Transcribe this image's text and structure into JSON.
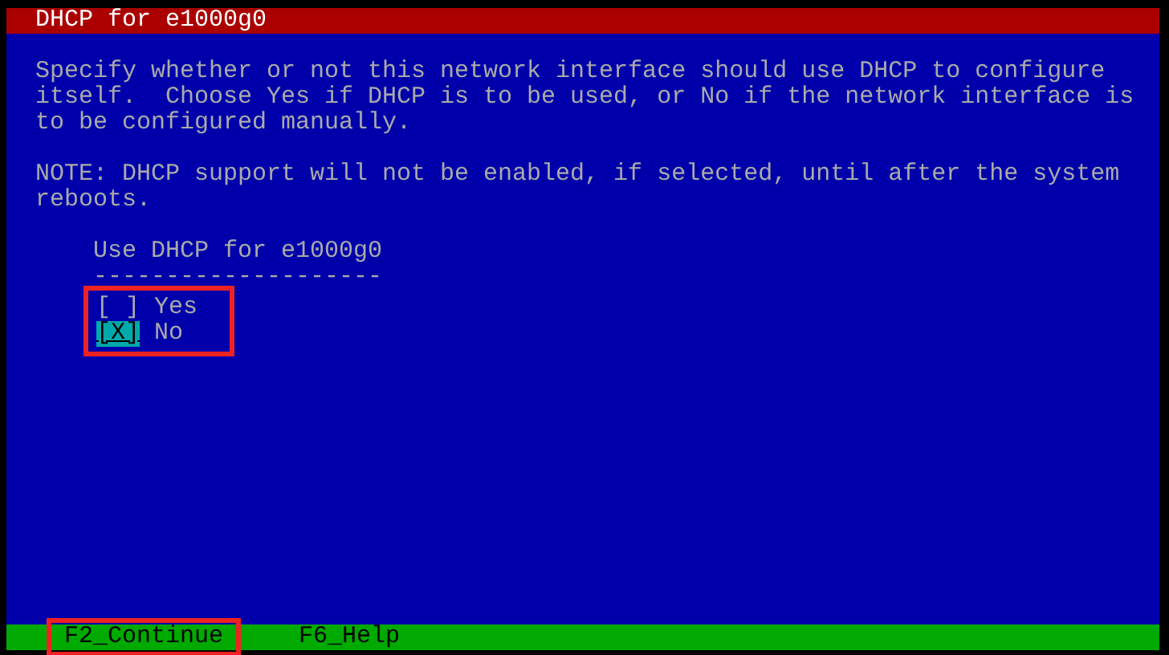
{
  "title": "DHCP for e1000g0",
  "description": "Specify whether or not this network interface should use DHCP to configure itself.  Choose Yes if DHCP is to be used, or No if the network interface is to be configured manually.",
  "note": "NOTE: DHCP support will not be enabled, if selected, until after the system reboots.",
  "question": {
    "label": "Use DHCP for e1000g0",
    "underline": "--------------------"
  },
  "checkbox_marks": {
    "checked": "[X]",
    "unchecked": "[ ]"
  },
  "options": [
    {
      "label": "Yes",
      "checked": false,
      "focused": false
    },
    {
      "label": "No",
      "checked": true,
      "focused": true
    }
  ],
  "function_keys": [
    {
      "label": "F2_Continue",
      "highlighted": true
    },
    {
      "label": "F6_Help",
      "highlighted": false
    }
  ]
}
